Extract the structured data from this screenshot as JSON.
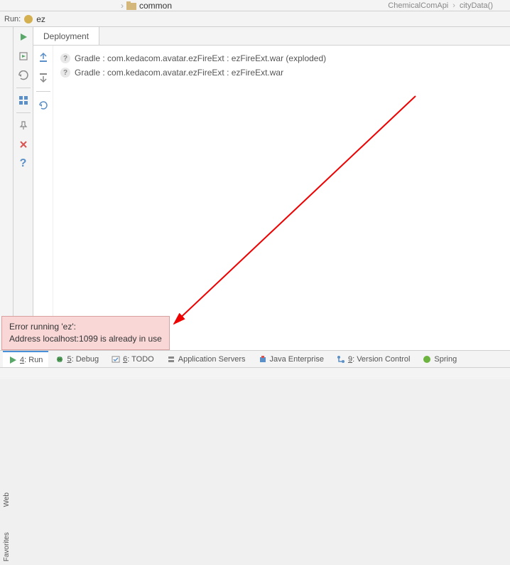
{
  "top": {
    "folder": "common",
    "breadcrumb_class": "ChemicalComApi",
    "breadcrumb_method": "cityData()"
  },
  "run_config": {
    "label": "Run:",
    "name": "ez"
  },
  "vertical_tabs": {
    "web": "Web",
    "favorites": "Favorites"
  },
  "tab_title": "Deployment",
  "deployments": [
    "Gradle : com.kedacom.avatar.ezFireExt : ezFireExt.war (exploded)",
    "Gradle : com.kedacom.avatar.ezFireExt : ezFireExt.war"
  ],
  "error": {
    "line1": "Error running 'ez':",
    "line2": "Address localhost:1099 is already in use"
  },
  "bottom_tabs": {
    "run": {
      "num": "4",
      "label": "Run"
    },
    "debug": {
      "num": "5",
      "label": "Debug"
    },
    "todo": {
      "num": "6",
      "label": "TODO"
    },
    "app_servers": "Application Servers",
    "java_ee": "Java Enterprise",
    "vcs": {
      "num": "9",
      "label": "Version Control"
    },
    "spring": "Spring"
  }
}
